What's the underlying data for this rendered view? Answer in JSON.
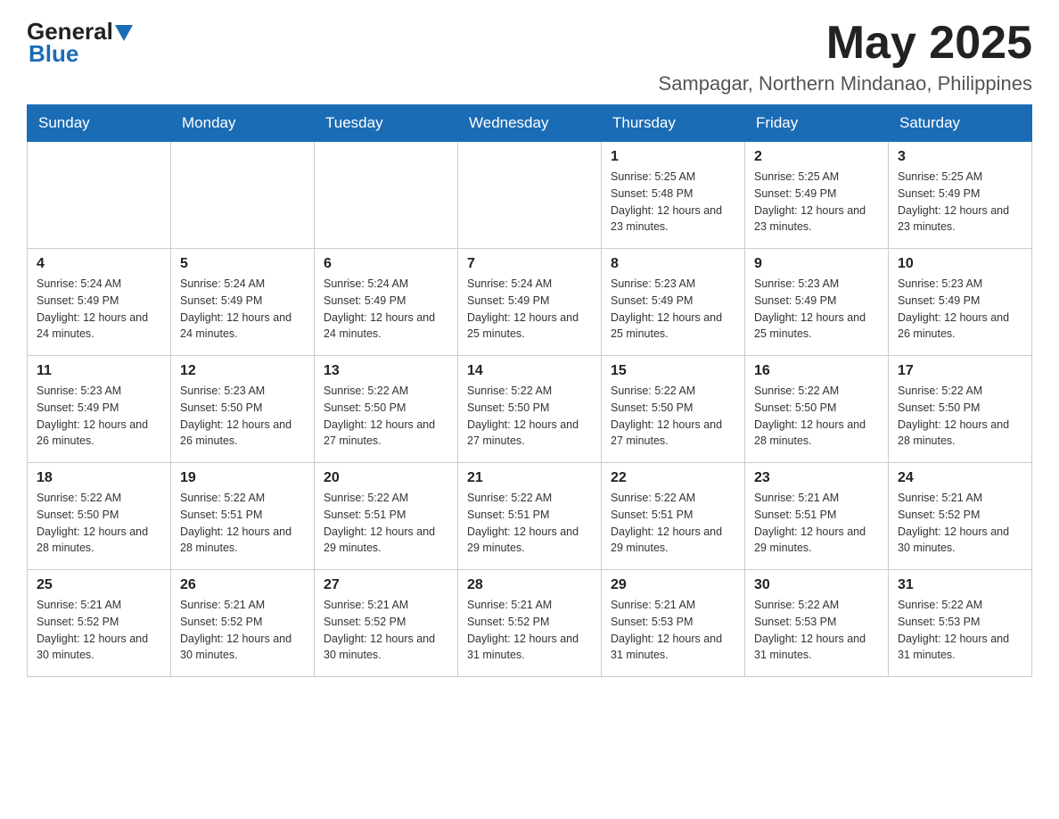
{
  "header": {
    "logo_general": "General",
    "logo_blue": "Blue",
    "month_title": "May 2025",
    "location": "Sampagar, Northern Mindanao, Philippines"
  },
  "weekdays": [
    "Sunday",
    "Monday",
    "Tuesday",
    "Wednesday",
    "Thursday",
    "Friday",
    "Saturday"
  ],
  "weeks": [
    [
      {
        "day": "",
        "info": ""
      },
      {
        "day": "",
        "info": ""
      },
      {
        "day": "",
        "info": ""
      },
      {
        "day": "",
        "info": ""
      },
      {
        "day": "1",
        "info": "Sunrise: 5:25 AM\nSunset: 5:48 PM\nDaylight: 12 hours\nand 23 minutes."
      },
      {
        "day": "2",
        "info": "Sunrise: 5:25 AM\nSunset: 5:49 PM\nDaylight: 12 hours\nand 23 minutes."
      },
      {
        "day": "3",
        "info": "Sunrise: 5:25 AM\nSunset: 5:49 PM\nDaylight: 12 hours\nand 23 minutes."
      }
    ],
    [
      {
        "day": "4",
        "info": "Sunrise: 5:24 AM\nSunset: 5:49 PM\nDaylight: 12 hours\nand 24 minutes."
      },
      {
        "day": "5",
        "info": "Sunrise: 5:24 AM\nSunset: 5:49 PM\nDaylight: 12 hours\nand 24 minutes."
      },
      {
        "day": "6",
        "info": "Sunrise: 5:24 AM\nSunset: 5:49 PM\nDaylight: 12 hours\nand 24 minutes."
      },
      {
        "day": "7",
        "info": "Sunrise: 5:24 AM\nSunset: 5:49 PM\nDaylight: 12 hours\nand 25 minutes."
      },
      {
        "day": "8",
        "info": "Sunrise: 5:23 AM\nSunset: 5:49 PM\nDaylight: 12 hours\nand 25 minutes."
      },
      {
        "day": "9",
        "info": "Sunrise: 5:23 AM\nSunset: 5:49 PM\nDaylight: 12 hours\nand 25 minutes."
      },
      {
        "day": "10",
        "info": "Sunrise: 5:23 AM\nSunset: 5:49 PM\nDaylight: 12 hours\nand 26 minutes."
      }
    ],
    [
      {
        "day": "11",
        "info": "Sunrise: 5:23 AM\nSunset: 5:49 PM\nDaylight: 12 hours\nand 26 minutes."
      },
      {
        "day": "12",
        "info": "Sunrise: 5:23 AM\nSunset: 5:50 PM\nDaylight: 12 hours\nand 26 minutes."
      },
      {
        "day": "13",
        "info": "Sunrise: 5:22 AM\nSunset: 5:50 PM\nDaylight: 12 hours\nand 27 minutes."
      },
      {
        "day": "14",
        "info": "Sunrise: 5:22 AM\nSunset: 5:50 PM\nDaylight: 12 hours\nand 27 minutes."
      },
      {
        "day": "15",
        "info": "Sunrise: 5:22 AM\nSunset: 5:50 PM\nDaylight: 12 hours\nand 27 minutes."
      },
      {
        "day": "16",
        "info": "Sunrise: 5:22 AM\nSunset: 5:50 PM\nDaylight: 12 hours\nand 28 minutes."
      },
      {
        "day": "17",
        "info": "Sunrise: 5:22 AM\nSunset: 5:50 PM\nDaylight: 12 hours\nand 28 minutes."
      }
    ],
    [
      {
        "day": "18",
        "info": "Sunrise: 5:22 AM\nSunset: 5:50 PM\nDaylight: 12 hours\nand 28 minutes."
      },
      {
        "day": "19",
        "info": "Sunrise: 5:22 AM\nSunset: 5:51 PM\nDaylight: 12 hours\nand 28 minutes."
      },
      {
        "day": "20",
        "info": "Sunrise: 5:22 AM\nSunset: 5:51 PM\nDaylight: 12 hours\nand 29 minutes."
      },
      {
        "day": "21",
        "info": "Sunrise: 5:22 AM\nSunset: 5:51 PM\nDaylight: 12 hours\nand 29 minutes."
      },
      {
        "day": "22",
        "info": "Sunrise: 5:22 AM\nSunset: 5:51 PM\nDaylight: 12 hours\nand 29 minutes."
      },
      {
        "day": "23",
        "info": "Sunrise: 5:21 AM\nSunset: 5:51 PM\nDaylight: 12 hours\nand 29 minutes."
      },
      {
        "day": "24",
        "info": "Sunrise: 5:21 AM\nSunset: 5:52 PM\nDaylight: 12 hours\nand 30 minutes."
      }
    ],
    [
      {
        "day": "25",
        "info": "Sunrise: 5:21 AM\nSunset: 5:52 PM\nDaylight: 12 hours\nand 30 minutes."
      },
      {
        "day": "26",
        "info": "Sunrise: 5:21 AM\nSunset: 5:52 PM\nDaylight: 12 hours\nand 30 minutes."
      },
      {
        "day": "27",
        "info": "Sunrise: 5:21 AM\nSunset: 5:52 PM\nDaylight: 12 hours\nand 30 minutes."
      },
      {
        "day": "28",
        "info": "Sunrise: 5:21 AM\nSunset: 5:52 PM\nDaylight: 12 hours\nand 31 minutes."
      },
      {
        "day": "29",
        "info": "Sunrise: 5:21 AM\nSunset: 5:53 PM\nDaylight: 12 hours\nand 31 minutes."
      },
      {
        "day": "30",
        "info": "Sunrise: 5:22 AM\nSunset: 5:53 PM\nDaylight: 12 hours\nand 31 minutes."
      },
      {
        "day": "31",
        "info": "Sunrise: 5:22 AM\nSunset: 5:53 PM\nDaylight: 12 hours\nand 31 minutes."
      }
    ]
  ]
}
